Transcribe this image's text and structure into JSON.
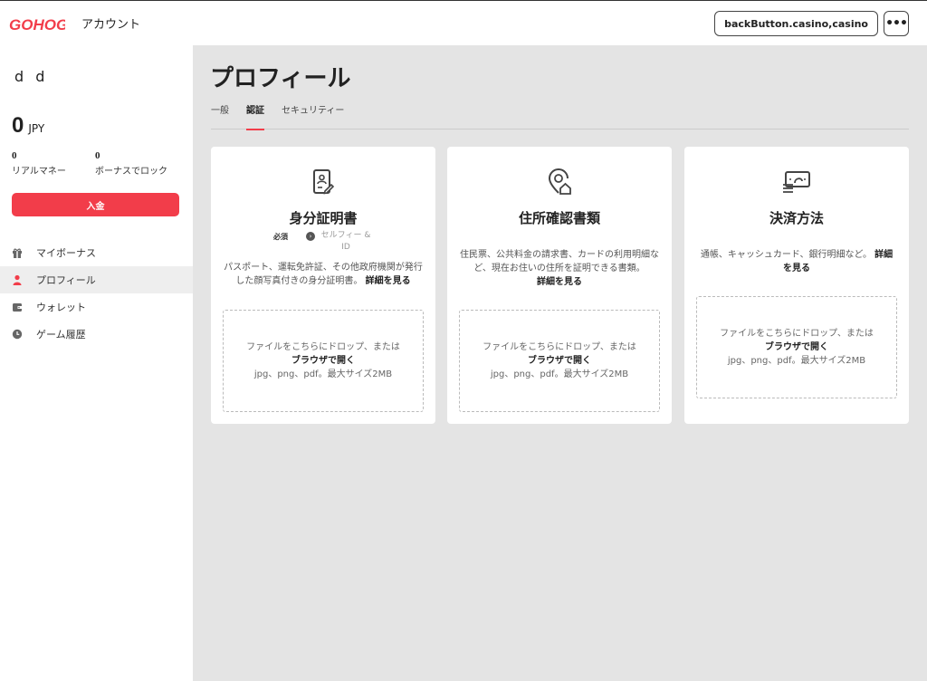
{
  "header": {
    "logo_text": "GOHOG!",
    "account_label": "アカウント",
    "domain_label": "backButton.casino,casino",
    "more_label": "•••"
  },
  "sidebar": {
    "username": "d d",
    "balance": {
      "amount": "0",
      "currency": "JPY"
    },
    "real_money": {
      "value": "0",
      "label": "リアルマネー"
    },
    "bonus_locked": {
      "value": "0",
      "label": "ボーナスでロック"
    },
    "deposit_label": "入金",
    "items": [
      {
        "label": "マイボーナス",
        "icon": "gift-icon",
        "active": false
      },
      {
        "label": "プロフィール",
        "icon": "user-icon",
        "active": true
      },
      {
        "label": "ウォレット",
        "icon": "wallet-icon",
        "active": false
      },
      {
        "label": "ゲーム履歴",
        "icon": "clock-icon",
        "active": false
      }
    ]
  },
  "main": {
    "title": "プロフィール",
    "tabs": [
      {
        "label": "一般",
        "active": false
      },
      {
        "label": "認証",
        "active": true
      },
      {
        "label": "セキュリティー",
        "active": false
      }
    ],
    "cards": [
      {
        "title": "身分証明書",
        "icon": "id-document-icon",
        "required_label": "必須",
        "selfie_label": "セルフィー & ID",
        "description": "パスポート、運転免許証、その他政府機関が発行した顔写真付きの身分証明書。",
        "more_label": "詳細を見る",
        "drop_text": "ファイルをこちらにドロップ、または",
        "browse_label": "ブラウザで開く",
        "file_hint": "jpg、png、pdf。最大サイズ2MB"
      },
      {
        "title": "住所確認書類",
        "icon": "location-home-icon",
        "description": "住民票、公共料金の請求書、カードの利用明細など、現在お住いの住所を証明できる書類。",
        "more_label": "詳細を見る",
        "drop_text": "ファイルをこちらにドロップ、または",
        "browse_label": "ブラウザで開く",
        "file_hint": "jpg、png、pdf。最大サイズ2MB"
      },
      {
        "title": "決済方法",
        "icon": "payment-icon",
        "description": "通帳、キャッシュカード、銀行明細など。",
        "more_label": "詳細を見る",
        "drop_text": "ファイルをこちらにドロップ、または",
        "browse_label": "ブラウザで開く",
        "file_hint": "jpg、png、pdf。最大サイズ2MB"
      }
    ]
  },
  "colors": {
    "accent": "#f23d4a",
    "background": "#e4e4e4",
    "sidebar_active": "#eeeeee"
  }
}
